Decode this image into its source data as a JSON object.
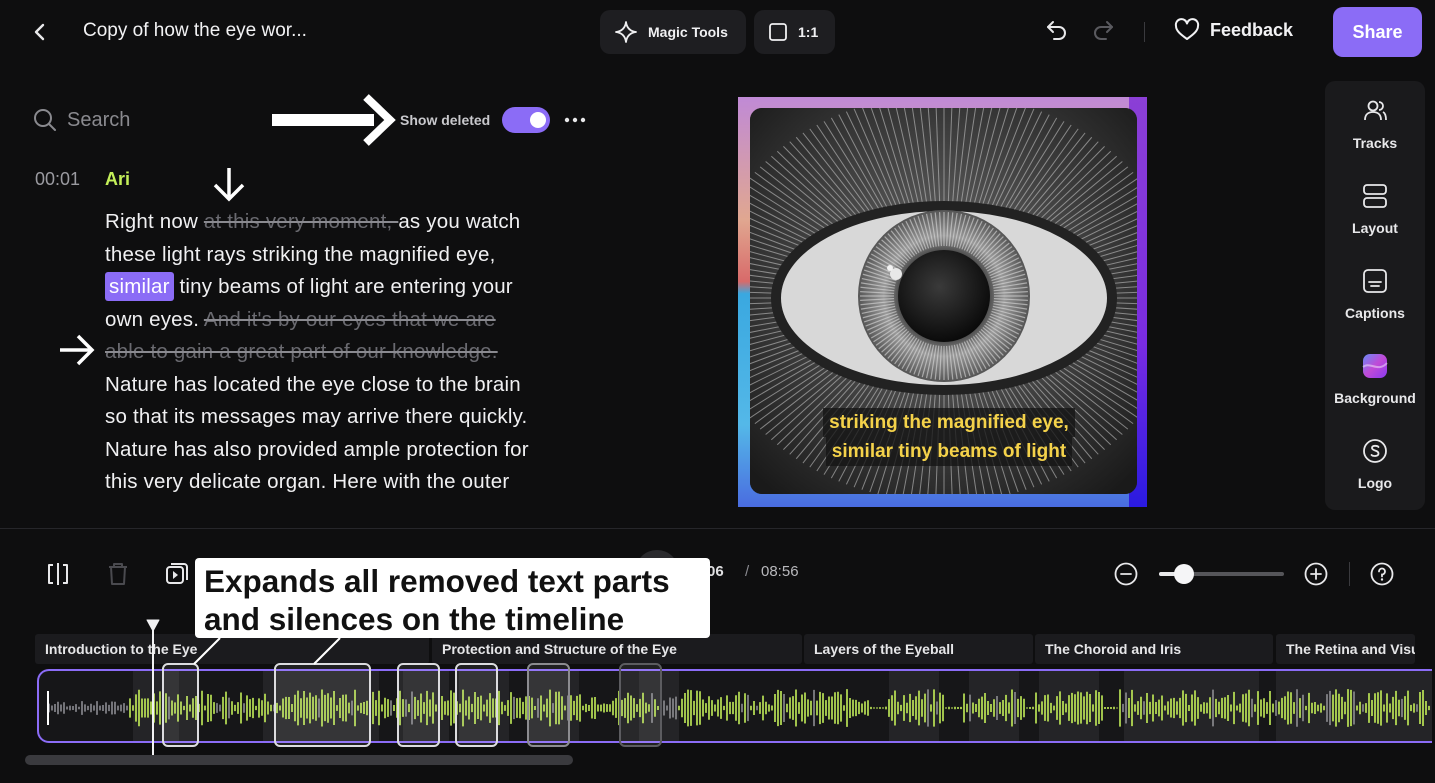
{
  "header": {
    "back_icon": "chevron-left-icon",
    "title": "Copy of how the eye wor...",
    "magic_tools": "Magic Tools",
    "aspect_ratio": "1:1",
    "feedback": "Feedback",
    "share": "Share"
  },
  "transcript": {
    "search_placeholder": "Search",
    "show_deleted_label": "Show deleted",
    "show_deleted_on": true,
    "timestamp": "00:01",
    "speaker": "Ari",
    "segments": [
      {
        "text": "Right now ",
        "deleted": false
      },
      {
        "text": "at this very moment, ",
        "deleted": true
      },
      {
        "text": "as you watch these light rays striking the magnified eye, ",
        "deleted": false
      },
      {
        "text": "similar",
        "deleted": false,
        "highlight": true
      },
      {
        "text": " tiny beams of light are entering your own eyes. ",
        "deleted": false
      },
      {
        "text": "And it's by our eyes that we are able to gain a great part of our knowledge. ",
        "deleted": true
      },
      {
        "text": "Nature has located the eye close to the brain so that its messages may arrive there quickly. Nature has also provided ample protection for this very delicate organ. Here with the outer",
        "deleted": false
      }
    ]
  },
  "preview": {
    "caption_line1": "striking the magnified eye,",
    "caption_line2": "similar tiny beams of light"
  },
  "sidebar": {
    "items": [
      {
        "label": "Tracks",
        "icon": "tracks-icon"
      },
      {
        "label": "Layout",
        "icon": "layout-icon"
      },
      {
        "label": "Captions",
        "icon": "captions-icon"
      },
      {
        "label": "Background",
        "icon": "background-icon"
      },
      {
        "label": "Logo",
        "icon": "logo-icon"
      }
    ]
  },
  "timeline": {
    "current_time": ":06",
    "separator": "/",
    "total_time": "08:56",
    "callout": "Expands all removed text parts and silences on the timeline",
    "chapters": [
      {
        "label": "Introduction to the Eye"
      },
      {
        "label": "Protection and Structure of the Eye"
      },
      {
        "label": "Layers of the Eyeball"
      },
      {
        "label": "The Choroid and Iris"
      },
      {
        "label": "The Retina and Visu"
      }
    ],
    "colors": {
      "accent": "#8b6cf6",
      "wave": "#c4ef59",
      "wave_muted": "#8d8d92"
    }
  }
}
